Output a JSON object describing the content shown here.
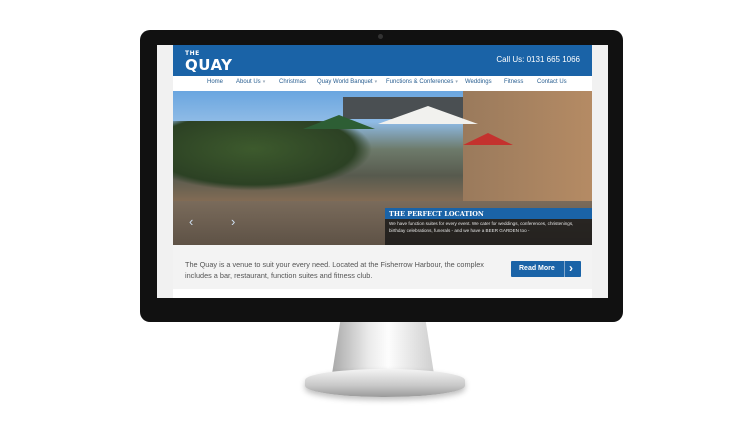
{
  "site": {
    "logo_small": "THE",
    "logo_big": "QUAY",
    "call_us": "Call Us: 0131 665 1066"
  },
  "nav": {
    "items": [
      {
        "label": "Home",
        "has_dropdown": false
      },
      {
        "label": "About Us",
        "has_dropdown": true
      },
      {
        "label": "Christmas",
        "has_dropdown": false
      },
      {
        "label": "Quay World Banquet",
        "has_dropdown": true
      },
      {
        "label": "Functions & Conferences",
        "has_dropdown": true
      },
      {
        "label": "Weddings",
        "has_dropdown": false
      },
      {
        "label": "Fitness",
        "has_dropdown": false
      },
      {
        "label": "Contact Us",
        "has_dropdown": false
      }
    ],
    "dropdown_glyph": "▾"
  },
  "hero": {
    "caption_title": "THE PERFECT LOCATION",
    "caption_text": "We have function suites for every event. We cater for weddings, conferences, christenings, birthday celebrations, funerals - and we have a BEER GARDEN too -",
    "prev_icon": "chevron-left-icon",
    "next_icon": "chevron-right-icon",
    "prev_glyph": "‹",
    "next_glyph": "›"
  },
  "intro": {
    "text": "The Quay is a venue to suit your every need. Located at the Fisherrow Harbour, the complex includes a bar, restaurant, function suites and fitness club.",
    "read_more": "Read More",
    "read_more_glyph": "›"
  },
  "colors": {
    "brand_blue": "#1a63a7",
    "nav_text": "#2a5f91",
    "monitor_bezel": "#111111"
  }
}
